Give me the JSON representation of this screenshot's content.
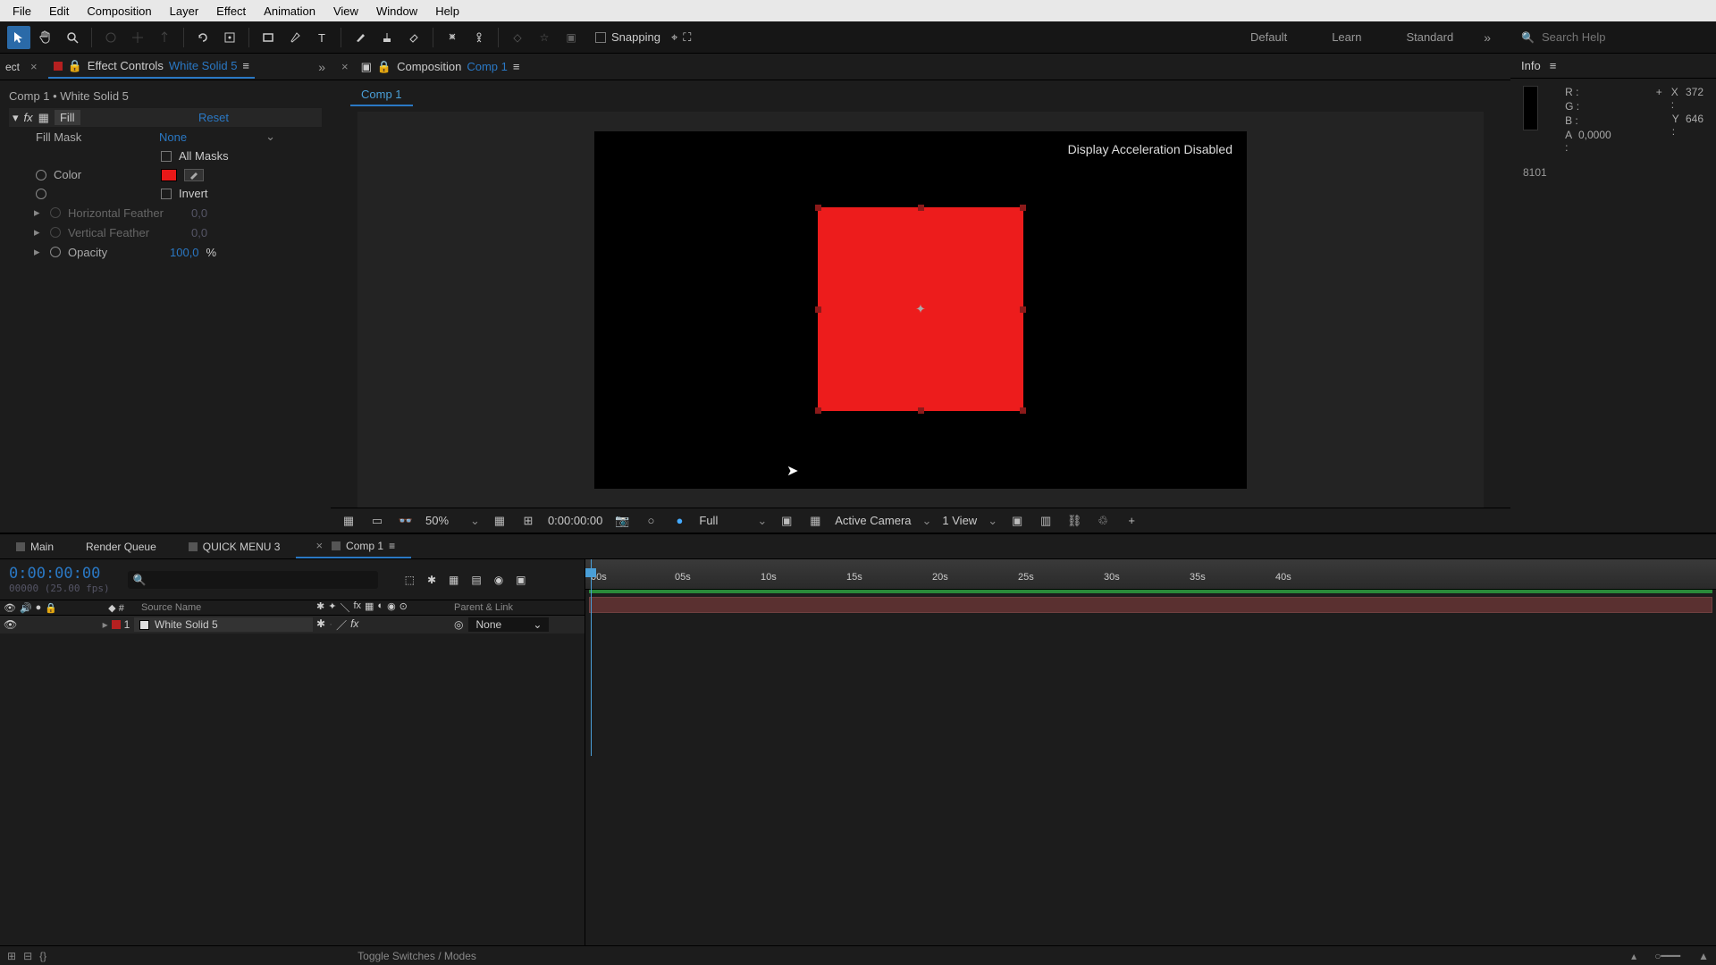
{
  "menu": [
    "File",
    "Edit",
    "Composition",
    "Layer",
    "Effect",
    "Animation",
    "View",
    "Window",
    "Help"
  ],
  "toolbar": {
    "snapping": "Snapping",
    "workspaces": [
      "Default",
      "Learn",
      "Standard"
    ],
    "search_placeholder": "Search Help"
  },
  "effectControls": {
    "tab_prefix": "ect",
    "title": "Effect Controls",
    "layer_name": "White Solid 5",
    "breadcrumb": "Comp 1 • White Solid 5",
    "fx_name": "Fill",
    "reset": "Reset",
    "rows": {
      "fill_mask": {
        "label": "Fill Mask",
        "value": "None"
      },
      "all_masks": "All Masks",
      "color": "Color",
      "invert": "Invert",
      "h_feather": {
        "label": "Horizontal Feather",
        "value": "0,0"
      },
      "v_feather": {
        "label": "Vertical Feather",
        "value": "0,0"
      },
      "opacity": {
        "label": "Opacity",
        "value": "100,0",
        "suffix": "%"
      }
    }
  },
  "composition": {
    "panel_title": "Composition",
    "name": "Comp 1",
    "crumb": "Comp 1",
    "overlay": "Display Acceleration Disabled"
  },
  "viewbar": {
    "zoom": "50%",
    "time": "0:00:00:00",
    "resolution": "Full",
    "camera": "Active Camera",
    "views": "1 View"
  },
  "info": {
    "title": "Info",
    "R": "R :",
    "G": "G :",
    "B": "B :",
    "A": "A :",
    "A_val": "0,0000",
    "X": "X :",
    "X_val": "372",
    "Y": "Y :",
    "Y_val": "646",
    "extra": "8101"
  },
  "timeline": {
    "tabs": [
      "Main",
      "Render Queue",
      "QUICK MENU 3",
      "Comp 1"
    ],
    "timecode": "0:00:00:00",
    "timecode_sub": "00000 (25.00 fps)",
    "col_source": "Source Name",
    "col_parent": "Parent & Link",
    "layer_num": "1",
    "layer_name": "White Solid 5",
    "parent_none": "None",
    "ticks": [
      "00s",
      "05s",
      "10s",
      "15s",
      "20s",
      "25s",
      "30s",
      "35s",
      "40s"
    ],
    "toggle": "Toggle Switches / Modes"
  }
}
